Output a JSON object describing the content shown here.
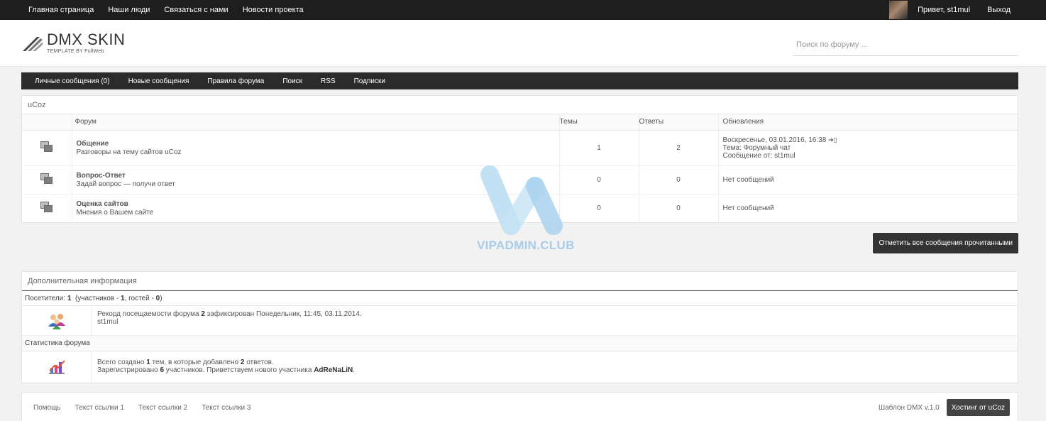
{
  "topbar": {
    "nav": [
      "Главная страница",
      "Наши люди",
      "Связаться с нами",
      "Новости проекта"
    ],
    "greeting": "Привет, st1mul",
    "logout": "Выход"
  },
  "header": {
    "logo_title": "DMX SKIN",
    "logo_sub": "TEMPLATE BY FullWeb",
    "search_placeholder": "Поиск по форуму ..."
  },
  "subnav": [
    "Личные сообщения (0)",
    "Новые сообщения",
    "Правила форума",
    "Поиск",
    "RSS",
    "Подписки"
  ],
  "category": {
    "title": "uCoz",
    "columns": {
      "forum": "Форум",
      "topics": "Темы",
      "replies": "Ответы",
      "updates": "Обновления"
    },
    "forums": [
      {
        "name": "Общение",
        "desc": "Разговоры на тему сайтов uCoz",
        "topics": "1",
        "replies": "2",
        "update_line1": "Воскресенье, 03.01.2016, 16:38",
        "update_line2": "Тема: Форумный чат",
        "update_line3": "Сообщение от: st1mul"
      },
      {
        "name": "Вопрос-Ответ",
        "desc": "Задай вопрос — получи ответ",
        "topics": "0",
        "replies": "0",
        "update_line1": "Нет сообщений"
      },
      {
        "name": "Оценка сайтов",
        "desc": "Мнения о Вашем сайте",
        "topics": "0",
        "replies": "0",
        "update_line1": "Нет сообщений"
      }
    ]
  },
  "mark_all_read": "Отметить все сообщения прочитанными",
  "info": {
    "title": "Дополнительная информация",
    "visitors_label": "Посетители:",
    "visitors_count": "1",
    "visitors_pre_members": "(участников -",
    "visitors_members": "1",
    "visitors_mid": ", гостей -",
    "visitors_guests": "0",
    "visitors_end": ")",
    "record_pre": "Рекорд посещаемости форума",
    "record_count": "2",
    "record_post": "зафиксирован Понедельник, 11:45, 03.11.2014.",
    "record_user": "st1mul",
    "stats_title": "Статистика форума",
    "stats_pre1": "Всего создано",
    "stats_topics": "1",
    "stats_mid1": "тем, в которые добавлено",
    "stats_replies": "2",
    "stats_post1": "ответов.",
    "stats_pre2": "Зарегистрировано",
    "stats_users": "6",
    "stats_mid2": "участников. Приветствуем нового участника",
    "stats_newuser": "AdReNaLiN",
    "stats_post2": "."
  },
  "footer": {
    "links": [
      "Помощь",
      "Текст ссылки 1",
      "Текст ссылки 2",
      "Текст ссылки 3"
    ],
    "template": "Шаблон DMX v.1.0",
    "hosting": "Хостинг от uCoz"
  },
  "watermark": "VIPADMIN.CLUB",
  "colors": {
    "topbar": "#1e1e1e",
    "subnav": "#2b2b2b",
    "watermark": "#a8cde8"
  }
}
